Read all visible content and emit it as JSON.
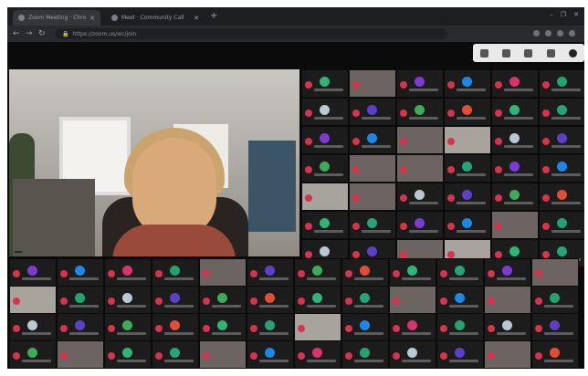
{
  "browser": {
    "tabs": [
      {
        "title": "Zoom Meeting · Chrome",
        "active": true
      },
      {
        "title": "Meet · Community Call",
        "active": false
      }
    ],
    "new_tab": "+",
    "window_controls": [
      "–",
      "❐",
      "✕"
    ],
    "address": "https://zoom.us/wc/join"
  },
  "meeting": {
    "speaker_name": "",
    "grid": {
      "rows": 10,
      "cols": 6,
      "big_cols": 6,
      "tile_w": 52,
      "tile_h": 31
    },
    "video_tiles": [
      1,
      14,
      15,
      19,
      20,
      24,
      25,
      34,
      38,
      39,
      46,
      53,
      54,
      62,
      64,
      72,
      79,
      82,
      88,
      92,
      101,
      105,
      108
    ],
    "avatar_colors": [
      "#2fb673",
      "#27a37a",
      "#7c3bd3",
      "#1e86e5",
      "#d9336f",
      "#24a36e",
      "#b8c8d4",
      "#5e3fc7",
      "#3faa5a",
      "#e04e3a"
    ],
    "control_icons": [
      "participants-icon",
      "chat-icon",
      "share-icon",
      "reactions-icon",
      "leave-icon"
    ]
  }
}
